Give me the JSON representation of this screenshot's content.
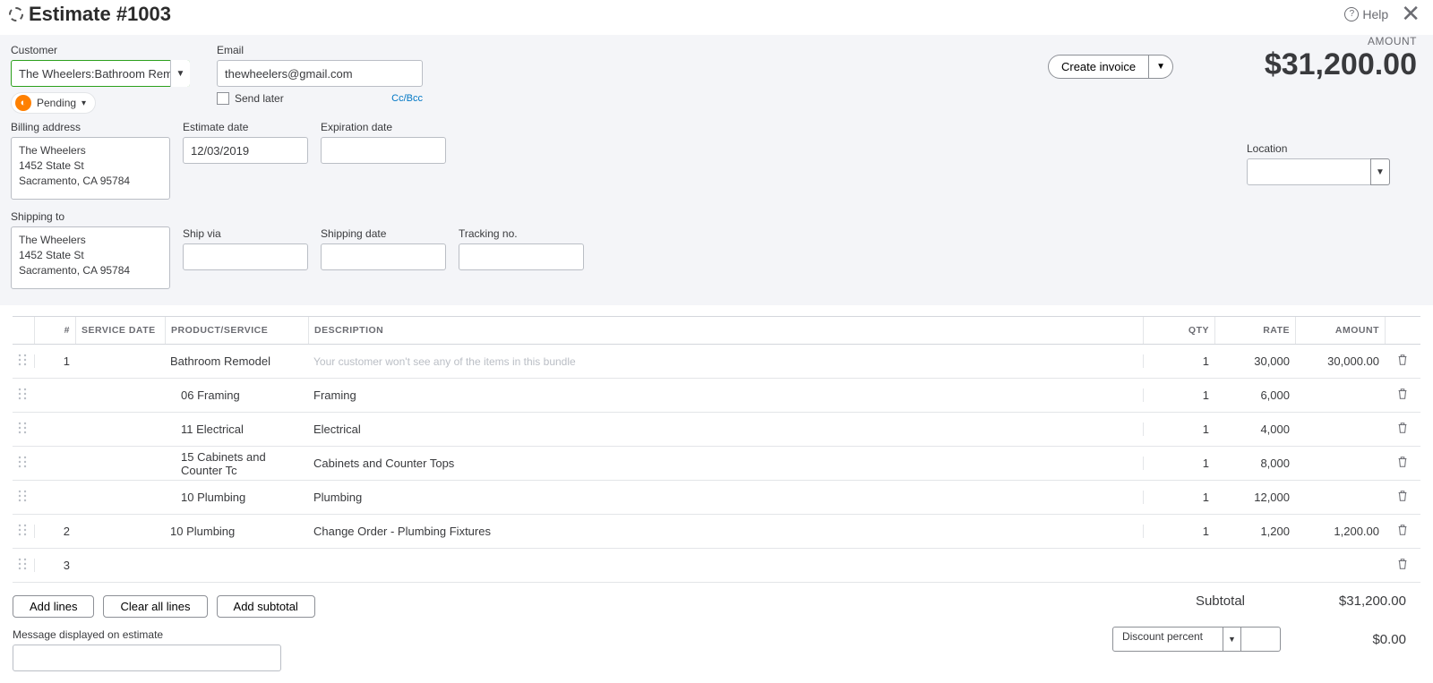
{
  "header": {
    "title": "Estimate #1003",
    "help": "Help"
  },
  "amount_block": {
    "label": "AMOUNT",
    "value": "$31,200.00"
  },
  "create_invoice": "Create invoice",
  "fields": {
    "customer_label": "Customer",
    "customer_value": "The Wheelers:Bathroom Remode",
    "email_label": "Email",
    "email_value": "thewheelers@gmail.com",
    "ccbcc": "Cc/Bcc",
    "send_later": "Send later",
    "pending": "Pending",
    "billing_label": "Billing address",
    "billing_value": "The Wheelers\n1452 State St\nSacramento, CA  95784",
    "shipping_label": "Shipping to",
    "shipping_value": "The Wheelers\n1452 State St\nSacramento, CA  95784",
    "estimate_date_label": "Estimate date",
    "estimate_date_value": "12/03/2019",
    "expiration_label": "Expiration date",
    "shipvia_label": "Ship via",
    "shipdate_label": "Shipping date",
    "tracking_label": "Tracking no.",
    "location_label": "Location"
  },
  "table": {
    "headers": {
      "num": "#",
      "service_date": "SERVICE DATE",
      "product": "PRODUCT/SERVICE",
      "description": "DESCRIPTION",
      "qty": "QTY",
      "rate": "RATE",
      "amount": "AMOUNT"
    },
    "rows": [
      {
        "drag": true,
        "num": "1",
        "product": "Bathroom Remodel",
        "description": "Your customer won't see any of the items in this bundle",
        "desc_ghost": true,
        "qty": "1",
        "rate": "30,000",
        "amount": "30,000.00",
        "trash": true,
        "indent": false
      },
      {
        "drag": true,
        "num": "",
        "product": "06 Framing",
        "description": "Framing",
        "qty": "1",
        "rate": "6,000",
        "amount": "",
        "trash": true,
        "indent": true
      },
      {
        "drag": true,
        "num": "",
        "product": "11 Electrical",
        "description": "Electrical",
        "qty": "1",
        "rate": "4,000",
        "amount": "",
        "trash": true,
        "indent": true
      },
      {
        "drag": true,
        "num": "",
        "product": "15 Cabinets and Counter Tc",
        "description": "Cabinets and Counter Tops",
        "qty": "1",
        "rate": "8,000",
        "amount": "",
        "trash": true,
        "indent": true
      },
      {
        "drag": true,
        "num": "",
        "product": "10 Plumbing",
        "description": "Plumbing",
        "qty": "1",
        "rate": "12,000",
        "amount": "",
        "trash": true,
        "indent": true
      },
      {
        "drag": true,
        "num": "2",
        "product": "10 Plumbing",
        "description": "Change Order - Plumbing Fixtures",
        "qty": "1",
        "rate": "1,200",
        "amount": "1,200.00",
        "trash": true,
        "indent": false
      },
      {
        "drag": true,
        "num": "3",
        "product": "",
        "description": "",
        "qty": "",
        "rate": "",
        "amount": "",
        "trash": true,
        "indent": false
      }
    ]
  },
  "actions": {
    "add_lines": "Add lines",
    "clear_lines": "Clear all lines",
    "add_subtotal": "Add subtotal"
  },
  "totals": {
    "subtotal_label": "Subtotal",
    "subtotal_value": "$31,200.00",
    "discount_label": "Discount percent",
    "discount_value": "$0.00"
  },
  "message_label": "Message displayed on estimate"
}
